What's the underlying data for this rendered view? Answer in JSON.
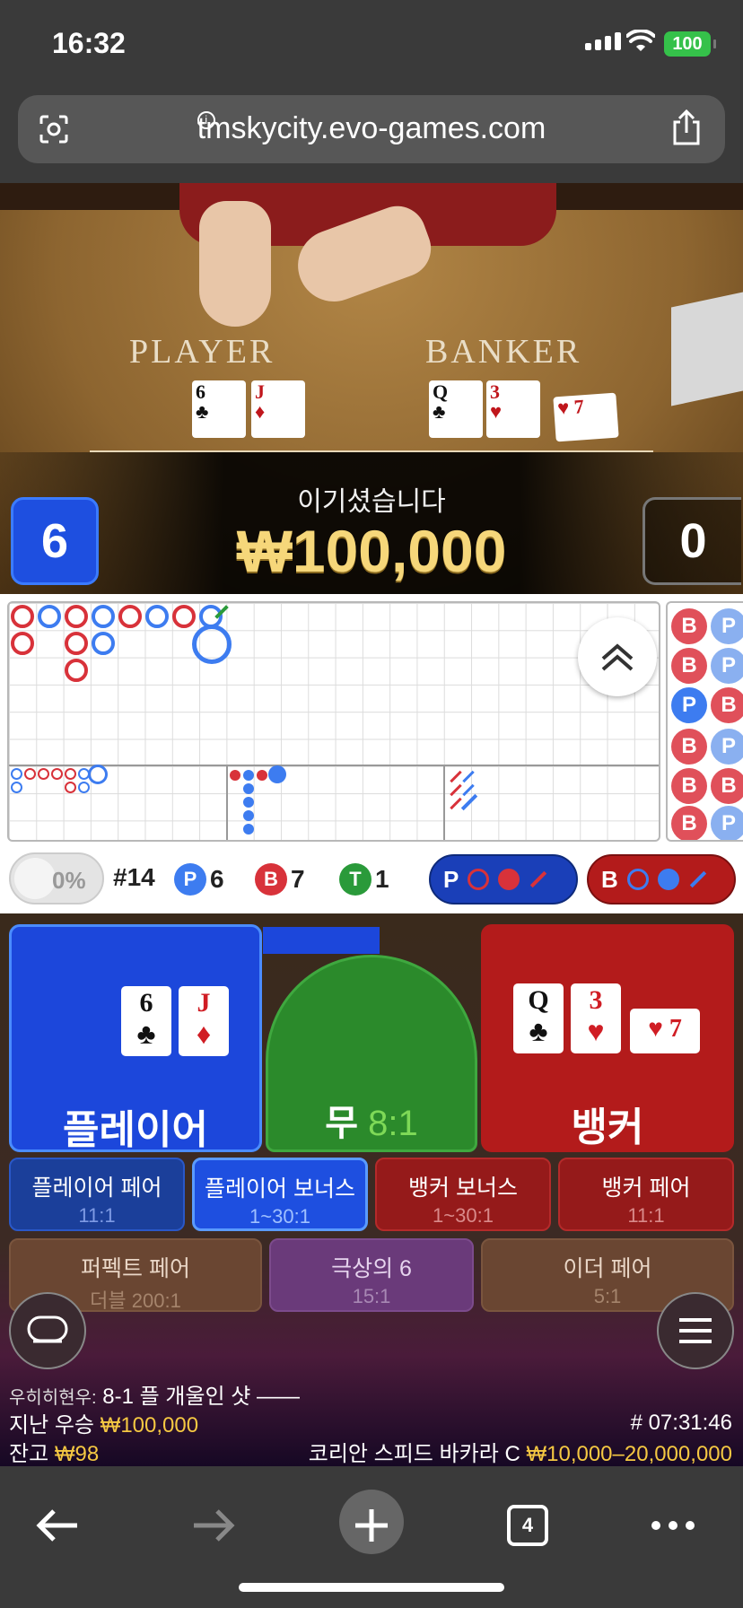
{
  "status_bar": {
    "time": "16:32",
    "battery": "100"
  },
  "browser": {
    "url": "tmskycity.evo-games.com",
    "tab_count": "4"
  },
  "video": {
    "player_label": "PLAYER",
    "banker_label": "BANKER",
    "player_cards": [
      {
        "rank": "6",
        "suit": "♣",
        "color": "black"
      },
      {
        "rank": "J",
        "suit": "♦",
        "color": "red"
      }
    ],
    "banker_cards": [
      {
        "rank": "Q",
        "suit": "♣",
        "color": "black"
      },
      {
        "rank": "3",
        "suit": "♥",
        "color": "red"
      },
      {
        "rank": "7",
        "suit": "♥",
        "color": "red"
      }
    ],
    "player_score": "6",
    "banker_score": "0",
    "win_text": "이기셨습니다",
    "win_amount": "₩100,000"
  },
  "stats": {
    "toggle_pct": "0%",
    "round": "#14",
    "player_label": "P",
    "player_count": "6",
    "banker_label": "B",
    "banker_count": "7",
    "tie_label": "T",
    "tie_count": "1",
    "predict_player": "P",
    "predict_banker": "B"
  },
  "bead_road": [
    [
      "B",
      "P"
    ],
    [
      "B",
      "P"
    ],
    [
      "P",
      "B"
    ],
    [
      "B",
      "P"
    ],
    [
      "B",
      "B"
    ],
    [
      "B",
      "P"
    ]
  ],
  "bets": {
    "player": {
      "label": "플레이어",
      "cards": [
        {
          "rank": "6",
          "suit": "♣",
          "color": "black"
        },
        {
          "rank": "J",
          "suit": "♦",
          "color": "red"
        }
      ]
    },
    "tie": {
      "label": "무",
      "odds": "8:1"
    },
    "banker": {
      "label": "뱅커",
      "cards": [
        {
          "rank": "Q",
          "suit": "♣",
          "color": "black"
        },
        {
          "rank": "3",
          "suit": "♥",
          "color": "red"
        },
        {
          "rank": "7",
          "suit": "♥",
          "color": "red"
        }
      ]
    },
    "side_bets": [
      {
        "name": "플레이어 페어",
        "odds": "11:1"
      },
      {
        "name": "플레이어 보너스",
        "odds": "1~30:1"
      },
      {
        "name": "뱅커 보너스",
        "odds": "1~30:1"
      },
      {
        "name": "뱅커 페어",
        "odds": "11:1"
      },
      {
        "name": "퍼펙트 페어",
        "odds": "더블 200:1"
      },
      {
        "name": "극상의 6",
        "odds": "15:1"
      },
      {
        "name": "이더 페어",
        "odds": "5:1"
      }
    ]
  },
  "info": {
    "chat_user": "우히히현우:",
    "chat_message": "8-1 플 개울인 샷 ——",
    "last_win_label": "지난 우승",
    "last_win_amount": "₩100,000",
    "balance_label": "잔고",
    "balance_amount": "₩98",
    "round_id": "# 07:31:46",
    "table_name": "코리안 스피드 바카라 C",
    "table_limit": "₩10,000–20,000,000"
  }
}
